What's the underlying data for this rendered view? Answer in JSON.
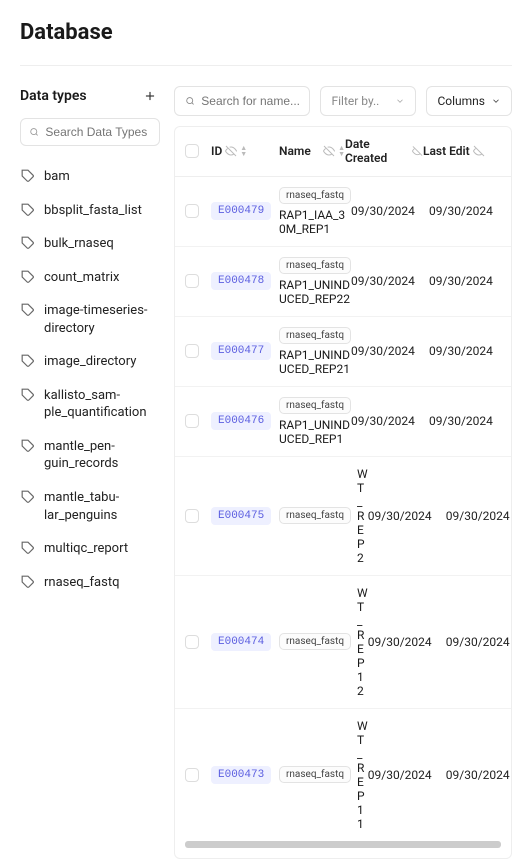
{
  "page_title": "Database",
  "sidebar": {
    "heading": "Data types",
    "search_placeholder": "Search Data Types",
    "items": [
      {
        "label": "bam"
      },
      {
        "label": "bbsplit_fasta_list"
      },
      {
        "label": "bulk_rnaseq"
      },
      {
        "label": "count_matrix"
      },
      {
        "label": "image-timeseries-directory"
      },
      {
        "label": "image_directory"
      },
      {
        "label": "kallisto_sam­ple_quantification"
      },
      {
        "label": "mantle_pen­guin_records"
      },
      {
        "label": "mantle_tabu­lar_penguins"
      },
      {
        "label": "multiqc_report"
      },
      {
        "label": "rnaseq_fastq"
      }
    ]
  },
  "toolbar": {
    "search_placeholder": "Search for name...",
    "filter_label": "Filter by..",
    "columns_label": "Columns"
  },
  "table": {
    "headers": {
      "id": "ID",
      "name": "Name",
      "date_created": "Date Created",
      "last_edit": "Last Edit"
    },
    "rows": [
      {
        "id": "E000479",
        "type": "rnaseq_fastq",
        "name": "RAP1_IAA_30M_REP1",
        "inline": false,
        "date_created": "09/30/2024",
        "last_edit": "09/30/2024"
      },
      {
        "id": "E000478",
        "type": "rnaseq_fastq",
        "name": "RAP1_UNINDUCED_REP22",
        "inline": false,
        "date_created": "09/30/2024",
        "last_edit": "09/30/2024"
      },
      {
        "id": "E000477",
        "type": "rnaseq_fastq",
        "name": "RAP1_UNINDUCED_REP21",
        "inline": false,
        "date_created": "09/30/2024",
        "last_edit": "09/30/2024"
      },
      {
        "id": "E000476",
        "type": "rnaseq_fastq",
        "name": "RAP1_UNINDUCED_REP1",
        "inline": false,
        "date_created": "09/30/2024",
        "last_edit": "09/30/2024"
      },
      {
        "id": "E000475",
        "type": "rnaseq_fastq",
        "name": "WT_REP2",
        "inline": true,
        "date_created": "09/30/2024",
        "last_edit": "09/30/2024"
      },
      {
        "id": "E000474",
        "type": "rnaseq_fastq",
        "name": "WT_REP12",
        "inline": true,
        "date_created": "09/30/2024",
        "last_edit": "09/30/2024"
      },
      {
        "id": "E000473",
        "type": "rnaseq_fastq",
        "name": "WT_REP11",
        "inline": true,
        "date_created": "09/30/2024",
        "last_edit": "09/30/2024"
      }
    ]
  }
}
